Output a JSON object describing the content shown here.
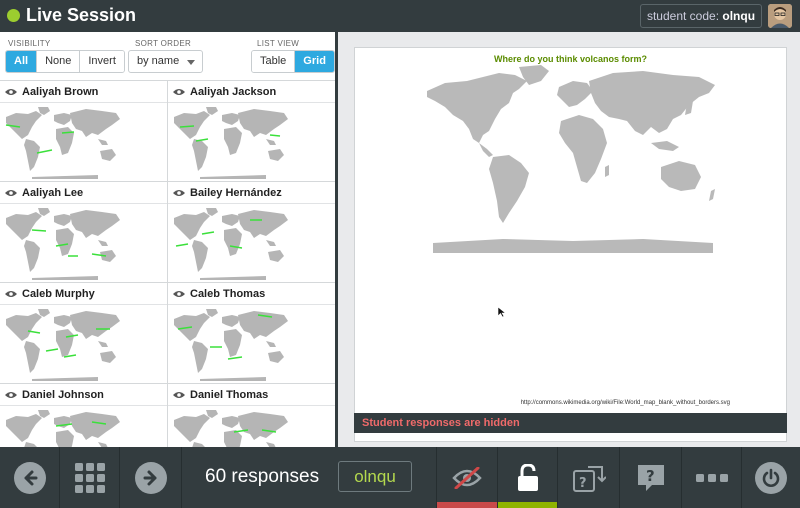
{
  "header": {
    "title": "Live Session",
    "student_code_label": "student code:",
    "student_code": "olnqu"
  },
  "controls": {
    "visibility_label": "VISIBILITY",
    "visibility_options": [
      "All",
      "None",
      "Invert"
    ],
    "visibility_selected": "All",
    "sort_label": "SORT ORDER",
    "sort_value": "by name",
    "list_view_label": "LIST VIEW",
    "list_view_options": [
      "Table",
      "Grid"
    ],
    "list_view_selected": "Grid"
  },
  "students": [
    {
      "name": "Aaliyah Brown"
    },
    {
      "name": "Aaliyah Jackson"
    },
    {
      "name": "Aaliyah Lee"
    },
    {
      "name": "Bailey Hernández"
    },
    {
      "name": "Caleb Murphy"
    },
    {
      "name": "Caleb Thomas"
    },
    {
      "name": "Daniel Johnson"
    },
    {
      "name": "Daniel Thomas"
    }
  ],
  "slide": {
    "question": "Where do you think volcanos form?",
    "credit": "http://commons.wikimedia.org/wiki/File:World_map_blank_without_borders.svg",
    "status": "Student responses are hidden"
  },
  "toolbar": {
    "responses": "60 responses",
    "code": "olnqu"
  },
  "colors": {
    "header_bg": "#333c3f",
    "accent_blue": "#2ea9e0",
    "live_green": "#9ccd2f",
    "question_green": "#5b8c00",
    "hidden_red": "#f06a6a",
    "eye_stripe": "#c94a4a",
    "lock_stripe": "#8fb300"
  }
}
